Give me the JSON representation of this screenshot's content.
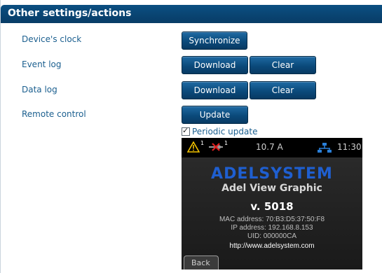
{
  "section": {
    "title": "Other settings/actions"
  },
  "rows": {
    "clock": {
      "label": "Device's clock",
      "button": "Synchronize"
    },
    "event_log": {
      "label": "Event log",
      "download": "Download",
      "clear": "Clear"
    },
    "data_log": {
      "label": "Data log",
      "download": "Download",
      "clear": "Clear"
    },
    "remote": {
      "label": "Remote control",
      "button": "Update"
    }
  },
  "periodic_update": {
    "label": "Periodic update",
    "checked": true,
    "check_glyph": "✓"
  },
  "device_screen": {
    "status_bar": {
      "warning_count": "1",
      "connection_count": "1",
      "current": "10.7 A",
      "time": "11:30",
      "icons": [
        "warning-icon",
        "disconnected-icon",
        "network-icon"
      ]
    },
    "brand": "ADELSYSTEM",
    "product": "Adel View Graphic",
    "version": "v. 5018",
    "mac": "MAC address: 70:B3:D5:37:50:F8",
    "ip": "IP address: 192.168.8.153",
    "uid": "UID: 000000CA",
    "url": "http://www.adelsystem.com",
    "back": "Back"
  },
  "colors": {
    "header": "#083c66",
    "label": "#1b5f8f",
    "button": "#0b4a7b",
    "brand": "#1f5fd0",
    "warning": "#f2c200"
  }
}
